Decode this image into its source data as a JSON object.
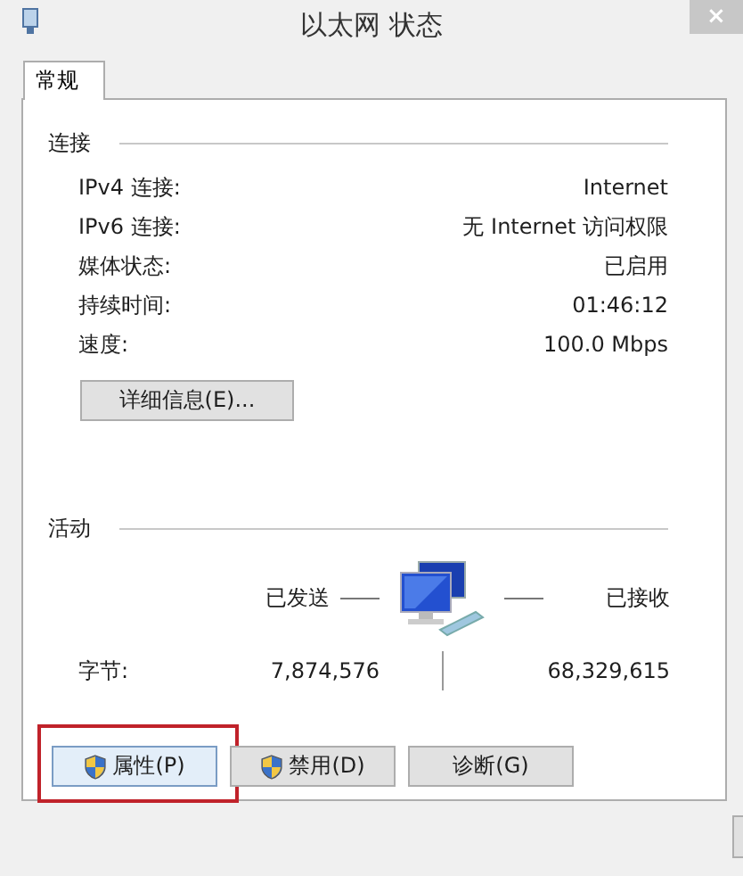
{
  "window": {
    "title": "以太网 状态",
    "close": "×"
  },
  "tabs": [
    {
      "label": "常规",
      "selected": true
    }
  ],
  "connection": {
    "heading": "连接",
    "rows": [
      {
        "label": "IPv4 连接:",
        "value": "Internet"
      },
      {
        "label": "IPv6 连接:",
        "value": "无 Internet 访问权限"
      },
      {
        "label": "媒体状态:",
        "value": "已启用"
      },
      {
        "label": "持续时间:",
        "value": "01:46:12"
      },
      {
        "label": "速度:",
        "value": "100.0 Mbps"
      }
    ],
    "details_button": "详细信息(E)..."
  },
  "activity": {
    "heading": "活动",
    "sent_label": "已发送",
    "received_label": "已接收",
    "bytes_label": "字节:",
    "bytes_sent": "7,874,576",
    "bytes_received": "68,329,615"
  },
  "buttons": [
    {
      "label": "属性(P)",
      "shield": true,
      "focused": true,
      "highlighted": true
    },
    {
      "label": "禁用(D)",
      "shield": true,
      "focused": false,
      "highlighted": false
    },
    {
      "label": "诊断(G)",
      "shield": false,
      "focused": false,
      "highlighted": false
    }
  ]
}
